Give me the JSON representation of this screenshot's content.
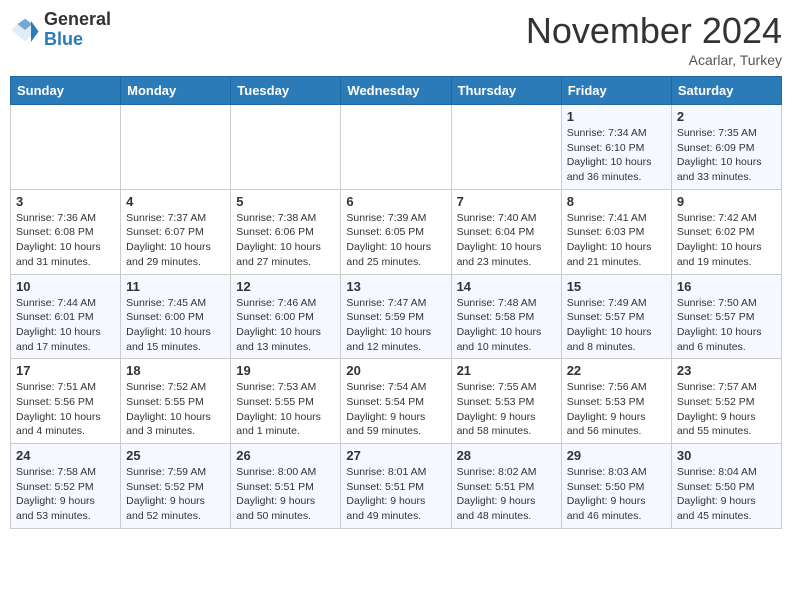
{
  "header": {
    "logo_line1": "General",
    "logo_line2": "Blue",
    "month": "November 2024",
    "location": "Acarlar, Turkey"
  },
  "weekdays": [
    "Sunday",
    "Monday",
    "Tuesday",
    "Wednesday",
    "Thursday",
    "Friday",
    "Saturday"
  ],
  "weeks": [
    [
      {
        "day": "",
        "content": ""
      },
      {
        "day": "",
        "content": ""
      },
      {
        "day": "",
        "content": ""
      },
      {
        "day": "",
        "content": ""
      },
      {
        "day": "",
        "content": ""
      },
      {
        "day": "1",
        "content": "Sunrise: 7:34 AM\nSunset: 6:10 PM\nDaylight: 10 hours and 36 minutes."
      },
      {
        "day": "2",
        "content": "Sunrise: 7:35 AM\nSunset: 6:09 PM\nDaylight: 10 hours and 33 minutes."
      }
    ],
    [
      {
        "day": "3",
        "content": "Sunrise: 7:36 AM\nSunset: 6:08 PM\nDaylight: 10 hours and 31 minutes."
      },
      {
        "day": "4",
        "content": "Sunrise: 7:37 AM\nSunset: 6:07 PM\nDaylight: 10 hours and 29 minutes."
      },
      {
        "day": "5",
        "content": "Sunrise: 7:38 AM\nSunset: 6:06 PM\nDaylight: 10 hours and 27 minutes."
      },
      {
        "day": "6",
        "content": "Sunrise: 7:39 AM\nSunset: 6:05 PM\nDaylight: 10 hours and 25 minutes."
      },
      {
        "day": "7",
        "content": "Sunrise: 7:40 AM\nSunset: 6:04 PM\nDaylight: 10 hours and 23 minutes."
      },
      {
        "day": "8",
        "content": "Sunrise: 7:41 AM\nSunset: 6:03 PM\nDaylight: 10 hours and 21 minutes."
      },
      {
        "day": "9",
        "content": "Sunrise: 7:42 AM\nSunset: 6:02 PM\nDaylight: 10 hours and 19 minutes."
      }
    ],
    [
      {
        "day": "10",
        "content": "Sunrise: 7:44 AM\nSunset: 6:01 PM\nDaylight: 10 hours and 17 minutes."
      },
      {
        "day": "11",
        "content": "Sunrise: 7:45 AM\nSunset: 6:00 PM\nDaylight: 10 hours and 15 minutes."
      },
      {
        "day": "12",
        "content": "Sunrise: 7:46 AM\nSunset: 6:00 PM\nDaylight: 10 hours and 13 minutes."
      },
      {
        "day": "13",
        "content": "Sunrise: 7:47 AM\nSunset: 5:59 PM\nDaylight: 10 hours and 12 minutes."
      },
      {
        "day": "14",
        "content": "Sunrise: 7:48 AM\nSunset: 5:58 PM\nDaylight: 10 hours and 10 minutes."
      },
      {
        "day": "15",
        "content": "Sunrise: 7:49 AM\nSunset: 5:57 PM\nDaylight: 10 hours and 8 minutes."
      },
      {
        "day": "16",
        "content": "Sunrise: 7:50 AM\nSunset: 5:57 PM\nDaylight: 10 hours and 6 minutes."
      }
    ],
    [
      {
        "day": "17",
        "content": "Sunrise: 7:51 AM\nSunset: 5:56 PM\nDaylight: 10 hours and 4 minutes."
      },
      {
        "day": "18",
        "content": "Sunrise: 7:52 AM\nSunset: 5:55 PM\nDaylight: 10 hours and 3 minutes."
      },
      {
        "day": "19",
        "content": "Sunrise: 7:53 AM\nSunset: 5:55 PM\nDaylight: 10 hours and 1 minute."
      },
      {
        "day": "20",
        "content": "Sunrise: 7:54 AM\nSunset: 5:54 PM\nDaylight: 9 hours and 59 minutes."
      },
      {
        "day": "21",
        "content": "Sunrise: 7:55 AM\nSunset: 5:53 PM\nDaylight: 9 hours and 58 minutes."
      },
      {
        "day": "22",
        "content": "Sunrise: 7:56 AM\nSunset: 5:53 PM\nDaylight: 9 hours and 56 minutes."
      },
      {
        "day": "23",
        "content": "Sunrise: 7:57 AM\nSunset: 5:52 PM\nDaylight: 9 hours and 55 minutes."
      }
    ],
    [
      {
        "day": "24",
        "content": "Sunrise: 7:58 AM\nSunset: 5:52 PM\nDaylight: 9 hours and 53 minutes."
      },
      {
        "day": "25",
        "content": "Sunrise: 7:59 AM\nSunset: 5:52 PM\nDaylight: 9 hours and 52 minutes."
      },
      {
        "day": "26",
        "content": "Sunrise: 8:00 AM\nSunset: 5:51 PM\nDaylight: 9 hours and 50 minutes."
      },
      {
        "day": "27",
        "content": "Sunrise: 8:01 AM\nSunset: 5:51 PM\nDaylight: 9 hours and 49 minutes."
      },
      {
        "day": "28",
        "content": "Sunrise: 8:02 AM\nSunset: 5:51 PM\nDaylight: 9 hours and 48 minutes."
      },
      {
        "day": "29",
        "content": "Sunrise: 8:03 AM\nSunset: 5:50 PM\nDaylight: 9 hours and 46 minutes."
      },
      {
        "day": "30",
        "content": "Sunrise: 8:04 AM\nSunset: 5:50 PM\nDaylight: 9 hours and 45 minutes."
      }
    ]
  ]
}
